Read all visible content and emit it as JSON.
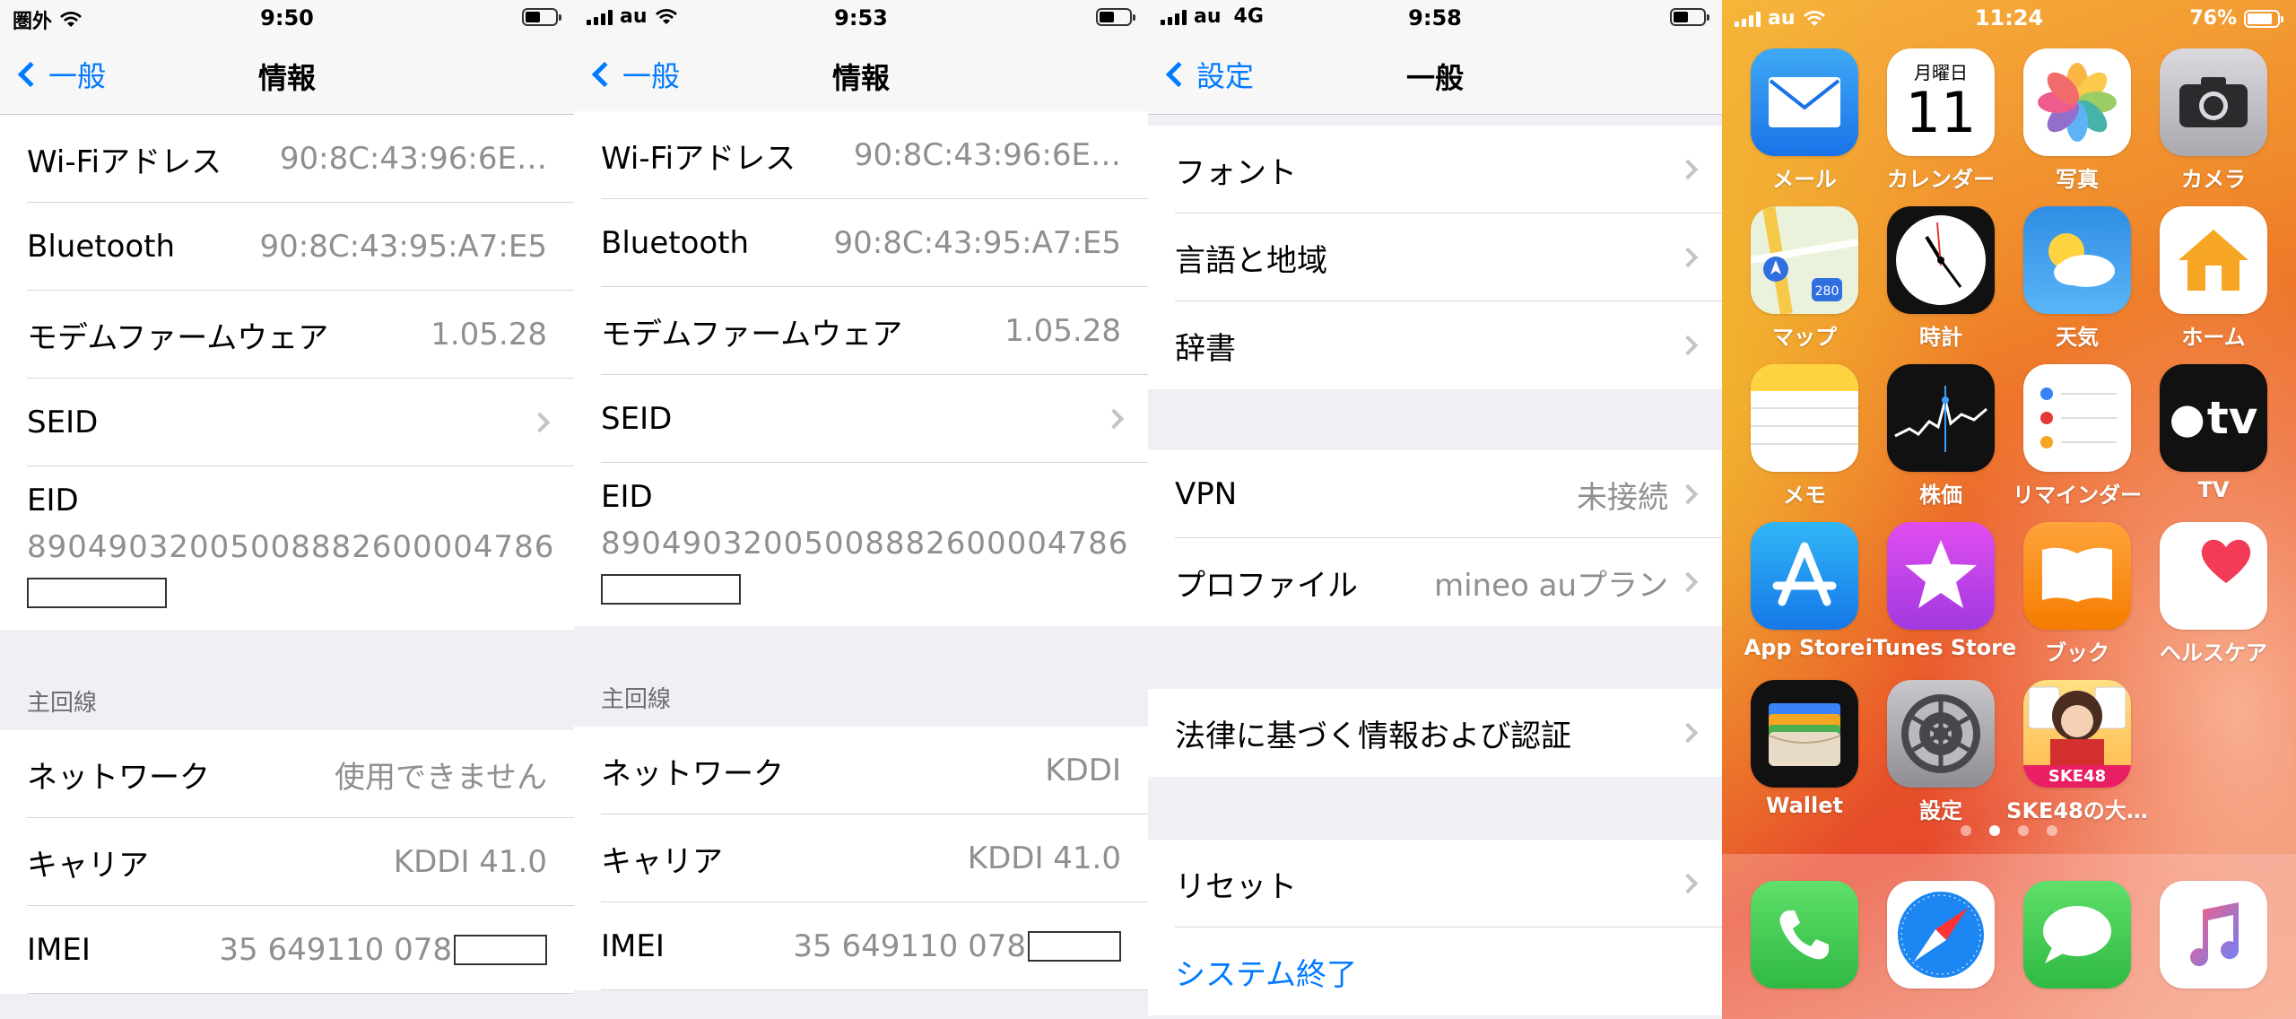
{
  "screen1": {
    "status": {
      "carrier": "圏外",
      "time": "9:50"
    },
    "nav": {
      "back": "一般",
      "title": "情報"
    },
    "rows": [
      {
        "label": "Wi-Fiアドレス",
        "value": "90:8C:43:96:6E…"
      },
      {
        "label": "Bluetooth",
        "value": "90:8C:43:95:A7:E5"
      },
      {
        "label": "モデムファームウェア",
        "value": "1.05.28"
      },
      {
        "label": "SEID",
        "value": ""
      }
    ],
    "eid": {
      "label": "EID",
      "value": "89049032005008882600004786"
    },
    "section": "主回線",
    "rows2": [
      {
        "label": "ネットワーク",
        "value": "使用できません"
      },
      {
        "label": "キャリア",
        "value": "KDDI 41.0"
      },
      {
        "label": "IMEI",
        "value": "35 649110 078"
      }
    ]
  },
  "screen2": {
    "status": {
      "carrier": "au",
      "time": "9:53"
    },
    "nav": {
      "back": "一般",
      "title": "情報"
    },
    "rows": [
      {
        "label": "Wi-Fiアドレス",
        "value": "90:8C:43:96:6E…"
      },
      {
        "label": "Bluetooth",
        "value": "90:8C:43:95:A7:E5"
      },
      {
        "label": "モデムファームウェア",
        "value": "1.05.28"
      },
      {
        "label": "SEID",
        "value": ""
      }
    ],
    "eid": {
      "label": "EID",
      "value": "89049032005008882600004786"
    },
    "section": "主回線",
    "rows2": [
      {
        "label": "ネットワーク",
        "value": "KDDI"
      },
      {
        "label": "キャリア",
        "value": "KDDI 41.0"
      },
      {
        "label": "IMEI",
        "value": "35 649110 078"
      }
    ]
  },
  "screen3": {
    "status": {
      "carrier": "au",
      "network": "4G",
      "time": "9:58"
    },
    "nav": {
      "back": "設定",
      "title": "一般"
    },
    "group1": [
      {
        "label": "フォント"
      },
      {
        "label": "言語と地域"
      },
      {
        "label": "辞書"
      }
    ],
    "group2": [
      {
        "label": "VPN",
        "value": "未接続"
      },
      {
        "label": "プロファイル",
        "value": "mineo auプラン"
      }
    ],
    "group3": [
      {
        "label": "法律に基づく情報および認証"
      }
    ],
    "group4": [
      {
        "label": "リセット"
      }
    ],
    "shutdown": "システム終了"
  },
  "screen4": {
    "status": {
      "carrier": "au",
      "time": "11:24",
      "battery": "76%"
    },
    "calendar": {
      "weekday": "月曜日",
      "day": "11"
    },
    "apps": [
      "メール",
      "カレンダー",
      "写真",
      "カメラ",
      "マップ",
      "時計",
      "天気",
      "ホーム",
      "メモ",
      "株価",
      "リマインダー",
      "TV",
      "App Store",
      "iTunes Store",
      "ブック",
      "ヘルスケア",
      "Wallet",
      "設定",
      "SKE48の大…"
    ],
    "tv_glyph": "tv",
    "ske_badge": "SKE48"
  }
}
